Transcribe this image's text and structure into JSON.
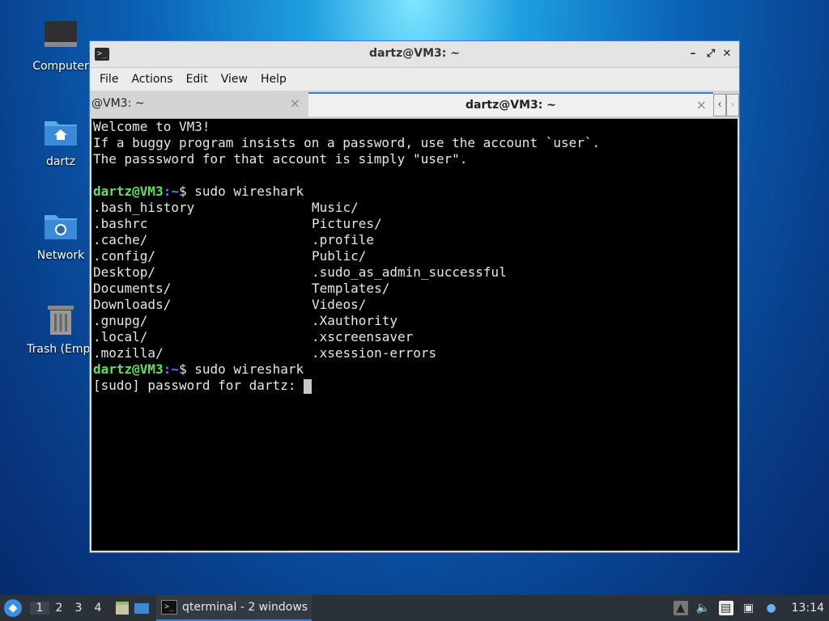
{
  "desktop": {
    "icons": [
      {
        "label": "Computer"
      },
      {
        "label": "dartz"
      },
      {
        "label": "Network"
      },
      {
        "label": "Trash (Empt"
      }
    ]
  },
  "window": {
    "title": "dartz@VM3: ~",
    "menu": [
      "File",
      "Actions",
      "Edit",
      "View",
      "Help"
    ],
    "tabs": [
      {
        "label": "@VM3: ~"
      },
      {
        "label": "dartz@VM3: ~"
      }
    ]
  },
  "terminal": {
    "welcome": [
      "Welcome to VM3!",
      "If a buggy program insists on a password, use the account `user`.",
      "The passsword for that account is simply \"user\"."
    ],
    "prompt_user": "dartz@VM3",
    "prompt_path": ":~",
    "prompt_symbol": "$ ",
    "command1": "sudo wireshark",
    "listing": [
      [
        ".bash_history",
        "Music/"
      ],
      [
        ".bashrc",
        "Pictures/"
      ],
      [
        ".cache/",
        ".profile"
      ],
      [
        ".config/",
        "Public/"
      ],
      [
        "Desktop/",
        ".sudo_as_admin_successful"
      ],
      [
        "Documents/",
        "Templates/"
      ],
      [
        "Downloads/",
        "Videos/"
      ],
      [
        ".gnupg/",
        ".Xauthority"
      ],
      [
        ".local/",
        ".xscreensaver"
      ],
      [
        ".mozilla/",
        ".xsession-errors"
      ]
    ],
    "command2": "sudo wireshark",
    "sudo_prompt": "[sudo] password for dartz: "
  },
  "taskbar": {
    "workspaces": [
      "1",
      "2",
      "3",
      "4"
    ],
    "task_label": "qterminal - 2 windows",
    "clock": "13:14"
  }
}
